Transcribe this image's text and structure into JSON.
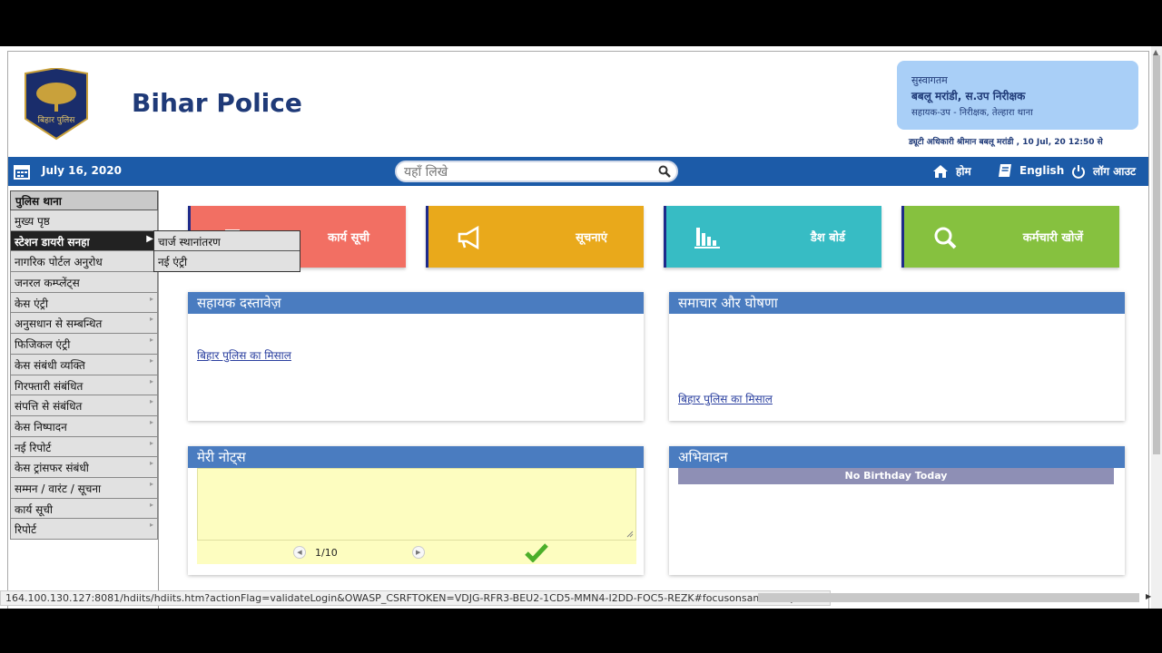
{
  "header": {
    "brand": "Bihar Police",
    "logo_text": "बिहार पुलिस",
    "welcome_greeting": "सुस्वागतम",
    "welcome_name": "बबलू मरांडी,  स.उप निरीक्षक",
    "welcome_role": "सहायक-उप - निरीक्षक, तेल्हारा थाना",
    "duty_text": "ड्यूटी अधिकारी श्रीमान बबलू मरांडी , 10 Jul, 20 12:50 से"
  },
  "navbar": {
    "date": "July 16, 2020",
    "search_placeholder": "यहाँ लिखे",
    "home": "होम",
    "language": "English",
    "logout": "लॉग आउट"
  },
  "sidebar": {
    "heading": "पुलिस थाना",
    "items": [
      {
        "label": "मुख्य पृष्ठ"
      },
      {
        "label": "स्टेशन डायरी सनहा"
      },
      {
        "label": "नागरिक पोर्टल अनुरोध"
      },
      {
        "label": "जनरल कम्प्लेंट्स"
      },
      {
        "label": "केस एंट्री"
      },
      {
        "label": "अनुसधान से सम्बन्धित"
      },
      {
        "label": "फिजिकल एंट्री"
      },
      {
        "label": "केस संबंधी व्यक्ति"
      },
      {
        "label": "गिरफ्तारी संबंधित"
      },
      {
        "label": "संपत्ति से संबंधित"
      },
      {
        "label": "केस निष्पादन"
      },
      {
        "label": "नई रिपोर्ट"
      },
      {
        "label": "केस ट्रांसफर संबंधी"
      },
      {
        "label": "सम्मन / वारंट / सूचना"
      },
      {
        "label": "कार्य सूची"
      },
      {
        "label": "रिपोर्ट"
      }
    ],
    "submenu": [
      "चार्ज स्थानांतरण",
      "नई एंट्री"
    ]
  },
  "tiles": [
    {
      "label": "कार्य सूची",
      "color": "#f26f63",
      "icon": "list-icon"
    },
    {
      "label": "सूचनाएं",
      "color": "#e9a91b",
      "icon": "megaphone-icon"
    },
    {
      "label": "डैश बोर्ड",
      "color": "#37bcc4",
      "icon": "bar-chart-icon"
    },
    {
      "label": "कर्मचारी खोजें",
      "color": "#86c13f",
      "icon": "search-icon"
    }
  ],
  "panels": {
    "documents": {
      "title": "सहायक दस्तावेज़",
      "link": "बिहार पुलिस का मिसाल"
    },
    "news": {
      "title": "समाचार और घोषणा",
      "link": "बिहार पुलिस का मिसाल"
    },
    "notes": {
      "title": "मेरी नोट्स",
      "pager": "1/10"
    },
    "greetings": {
      "title": "अभिवादन",
      "birthday": "No Birthday Today"
    }
  },
  "status_url": "164.100.130.127:8081/hdiits/hdiits.htm?actionFlag=validateLogin&OWASP_CSRFTOKEN=VDJG-RFR3-BEU2-1CD5-MMN4-I2DD-FOC5-REZK#focusonsamecomponent",
  "colors": {
    "navbar": "#1c5ba8",
    "panel_header": "#4a7cc0",
    "brand": "#1f3a78"
  }
}
